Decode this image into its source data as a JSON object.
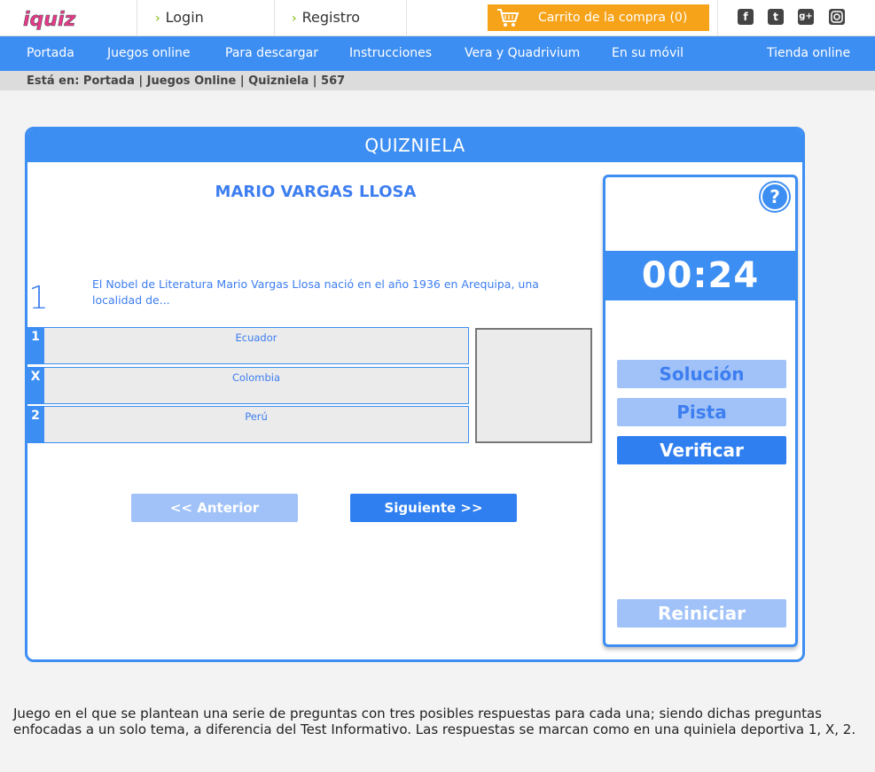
{
  "header": {
    "logo_text": "iquiz",
    "login_label": "Login",
    "register_label": "Registro",
    "cart_label": "Carrito de la compra (0)"
  },
  "social": {
    "icons": [
      "facebook-icon",
      "twitter-icon",
      "googleplus-icon",
      "instagram-icon"
    ]
  },
  "nav": {
    "items": [
      "Portada",
      "Juegos online",
      "Para descargar",
      "Instrucciones",
      "Vera y Quadrivium",
      "En su móvil",
      "Tienda online"
    ]
  },
  "breadcrumb": "Está en: Portada | Juegos Online | Quizniela | 567",
  "game": {
    "header": "QUIZNIELA",
    "title": "MARIO VARGAS LLOSA",
    "question_number": "1",
    "question_text": "El Nobel de Literatura Mario Vargas Llosa nació en el año 1936 en Arequipa, una localidad de...",
    "answers": [
      {
        "key": "1",
        "text": "Ecuador"
      },
      {
        "key": "X",
        "text": "Colombia"
      },
      {
        "key": "2",
        "text": "Perú"
      }
    ],
    "prev_label": "<< Anterior",
    "next_label": "Siguiente >>"
  },
  "side": {
    "help_label": "?",
    "timer": "00:24",
    "solution_label": "Solución",
    "hint_label": "Pista",
    "verify_label": "Verificar",
    "reset_label": "Reiniciar"
  },
  "description": "Juego en el que se plantean una serie de preguntas con tres posibles respuestas para cada una; siendo dichas preguntas enfocadas a un solo tema, a diferencia del Test Informativo. Las respuestas se marcan como en una quiniela deportiva 1, X, 2.",
  "colors": {
    "accent": "#3d8ef2",
    "cart": "#f7a319",
    "button_light": "#a0c2f8",
    "chevron": "#7ab800"
  }
}
